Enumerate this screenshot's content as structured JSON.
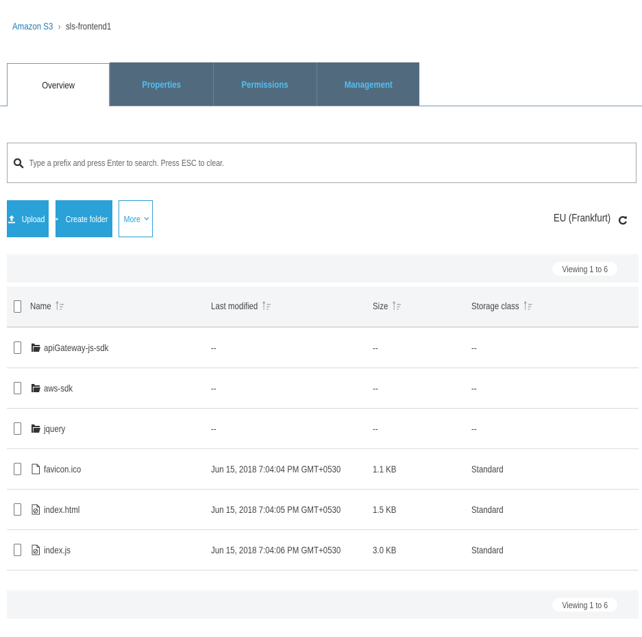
{
  "breadcrumb": {
    "root": "Amazon S3",
    "separator": "›",
    "current": "sls-frontend1"
  },
  "tabs": [
    {
      "label": "Overview",
      "active": true
    },
    {
      "label": "Properties",
      "active": false
    },
    {
      "label": "Permissions",
      "active": false
    },
    {
      "label": "Management",
      "active": false
    }
  ],
  "search": {
    "placeholder": "Type a prefix and press Enter to search. Press ESC to clear.",
    "value": ""
  },
  "toolbar": {
    "upload_label": "Upload",
    "create_folder_label": "Create folder",
    "more_label": "More",
    "region": "EU (Frankfurt)"
  },
  "viewing": {
    "top": "Viewing 1 to 6",
    "bottom": "Viewing 1 to 6"
  },
  "table": {
    "columns": [
      "Name",
      "Last modified",
      "Size",
      "Storage class"
    ],
    "rows": [
      {
        "type": "folder",
        "icon": "folder-icon",
        "name": "apiGateway-js-sdk",
        "last_modified": "--",
        "size": "--",
        "storage_class": "--"
      },
      {
        "type": "folder",
        "icon": "folder-icon",
        "name": "aws-sdk",
        "last_modified": "--",
        "size": "--",
        "storage_class": "--"
      },
      {
        "type": "folder",
        "icon": "folder-icon",
        "name": "jquery",
        "last_modified": "--",
        "size": "--",
        "storage_class": "--"
      },
      {
        "type": "file",
        "icon": "file-icon",
        "name": "favicon.ico",
        "last_modified": "Jun 15, 2018 7:04:04 PM GMT+0530",
        "size": "1.1 KB",
        "storage_class": "Standard"
      },
      {
        "type": "file",
        "icon": "code-file-icon",
        "name": "index.html",
        "last_modified": "Jun 15, 2018 7:04:05 PM GMT+0530",
        "size": "1.5 KB",
        "storage_class": "Standard"
      },
      {
        "type": "file",
        "icon": "code-file-icon",
        "name": "index.js",
        "last_modified": "Jun 15, 2018 7:04:06 PM GMT+0530",
        "size": "3.0 KB",
        "storage_class": "Standard"
      }
    ]
  },
  "colors": {
    "accent": "#2aa1d7",
    "tab_bg": "#526a7e",
    "tab_text": "#4fc0f2",
    "link": "#1f7bb5"
  }
}
